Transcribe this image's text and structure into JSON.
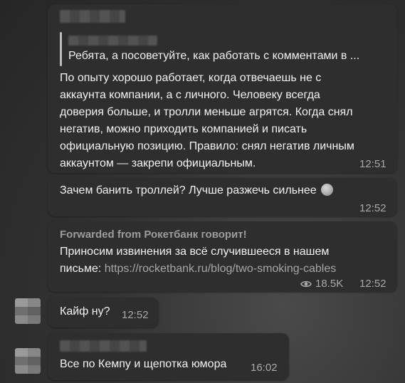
{
  "messages": {
    "first": {
      "reply_text": "Ребята, а посоветуйте, как работать с комментами в ...",
      "lines": [
        "По опыту хорошо работает, когда отвечаешь не с",
        "аккаунта компании, а с личного. Человеку всегда",
        "доверия больше, и тролли меньше агрятся. Когда снял",
        "негатив, можно приходить компанией и писать",
        "официальную позицию. Правило: снял негатив личным",
        "аккаунтом — закрепи официальным."
      ],
      "time": "12:51"
    },
    "second": {
      "text": "Зачем банить троллей? Лучше разжечь сильнее",
      "emoji": "winking-face",
      "time": "12:52"
    },
    "third": {
      "forward_title": "Forwarded from Рокетбанк говорит!",
      "line1": "Приносим извинения за всё случившееся в нашем",
      "line2_prefix": "письме: ",
      "link": "https://rocketbank.ru/blog/two-smoking-cables",
      "views": "18.5K",
      "time": "12:52"
    },
    "fourth": {
      "text": "Кайф ну?",
      "time": "12:52"
    },
    "fifth": {
      "text": "Все по Кемпу и щепотка юмора",
      "time": "16:02"
    }
  }
}
